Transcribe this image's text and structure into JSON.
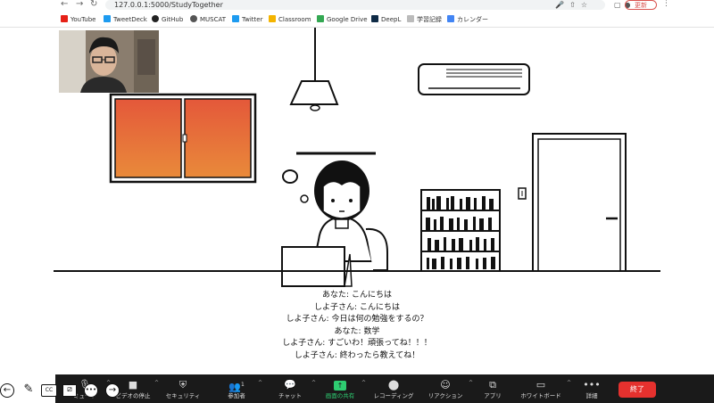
{
  "browser": {
    "url": "127.0.0.1:5000/StudyTogether",
    "update_label": "更新",
    "bookmarks": [
      {
        "label": "YouTube",
        "color": "#e62117"
      },
      {
        "label": "TweetDeck",
        "color": "#1d9bf0"
      },
      {
        "label": "GitHub",
        "color": "#222222"
      },
      {
        "label": "MUSCAT",
        "color": "#555555"
      },
      {
        "label": "Twitter",
        "color": "#1d9bf0"
      },
      {
        "label": "Classroom",
        "color": "#f4b400"
      },
      {
        "label": "Google Drive",
        "color": "#34a853"
      },
      {
        "label": "DeepL",
        "color": "#0f2b46"
      },
      {
        "label": "学習記録",
        "color": "#bbbbbb"
      },
      {
        "label": "カレンダー",
        "color": "#4285f4"
      }
    ]
  },
  "chat": {
    "lines": [
      "あなた: こんにちは",
      "しよ子さん: こんにちは",
      "しよ子さん: 今日は何の勉強をするの？",
      "あなた: 数学",
      "しよ子さん: すごいわ！頑張ってね！！！",
      "しよ子さん: 終わったら教えてね！"
    ]
  },
  "zoom_toolbar": {
    "items": [
      {
        "label": "ミュート",
        "icon": "mic-icon"
      },
      {
        "label": "ビデオの停止",
        "icon": "video-icon"
      },
      {
        "label": "セキュリティ",
        "icon": "shield-icon"
      },
      {
        "label": "参加者",
        "icon": "participants-icon",
        "count": "1"
      },
      {
        "label": "チャット",
        "icon": "chat-icon"
      },
      {
        "label": "画面の共有",
        "icon": "share-screen-icon"
      },
      {
        "label": "レコーディング",
        "icon": "record-icon"
      },
      {
        "label": "リアクション",
        "icon": "reaction-icon"
      },
      {
        "label": "アプリ",
        "icon": "apps-icon"
      },
      {
        "label": "ホワイトボード",
        "icon": "whiteboard-icon"
      },
      {
        "label": "詳細",
        "icon": "more-icon"
      }
    ],
    "end_label": "終了",
    "share_color": "#2ecc71",
    "end_color": "#e5312e"
  },
  "overlay": {
    "cc_label": "CC"
  }
}
